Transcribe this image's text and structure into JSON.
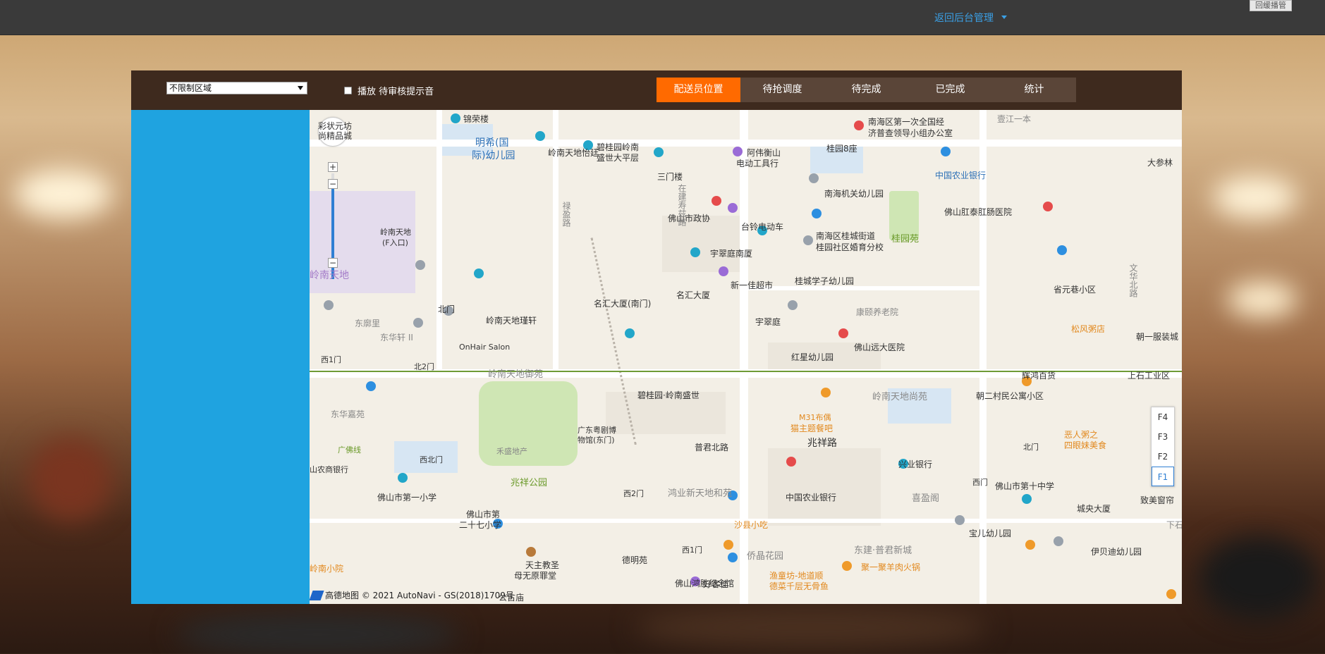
{
  "header": {
    "back_link": "返回后台管理",
    "corner_button": "回缓播管"
  },
  "toolbar": {
    "region_select": {
      "value": "不限制区域"
    },
    "sound_toggle_label": "播放 待审核提示音",
    "tabs": [
      {
        "label": "配送员位置",
        "active": true
      },
      {
        "label": "待抢调度",
        "active": false
      },
      {
        "label": "待完成",
        "active": false
      },
      {
        "label": "已完成",
        "active": false
      },
      {
        "label": "统计",
        "active": false
      }
    ]
  },
  "map": {
    "floors": [
      "F4",
      "F3",
      "F2",
      "F1"
    ],
    "active_floor": "F1",
    "attribution": "高德地图 © 2021 AutoNavi - GS(2018)1709号",
    "labels": {
      "l1": "彩状元坊",
      "l2": "尚精品城",
      "l3": "锦荣楼",
      "l4": "明希(国",
      "l5": "际)幼儿园",
      "l6": "岭南天地怡廷",
      "l7": "碧桂园岭南",
      "l8": "盛世大平层",
      "l9": "三门楼",
      "l10": "阿伟衡山",
      "l11": "电动工具行",
      "l12": "桂园8座",
      "l13": "南海区第一次全国经",
      "l14": "济普查领导小组办公室",
      "l15": "壹江一本",
      "l16": "中国农业银行",
      "l17": "大参林",
      "l18": "南海机关幼儿园",
      "l19": "佛山肛泰肛肠医院",
      "l20": "桂园苑",
      "l21": "佛山市政协",
      "l22": "台铃电动车",
      "l23": "南海区桂城街道",
      "l24": "桂园社区婚育分校",
      "l25": "宇翠庭南厦",
      "l26": "岭南天地",
      "l27": "(F入口)",
      "l28": "岭南天地",
      "l29": "新一佳超市",
      "l30": "名汇大厦",
      "l31": "桂城学子幼儿园",
      "l32": "省元巷小区",
      "l33": "名汇大厦(南门)",
      "l34": "宇翠庭",
      "l35": "康颐养老院",
      "l36": "岭南天地瑾轩",
      "l37": "北门",
      "l38": "东廓里",
      "l39": "东华轩 II",
      "l40": "松风粥店",
      "l41": "朝一服装城",
      "l42": "佛山远大医院",
      "l43": "OnHair Salon",
      "l44": "西1门",
      "l45": "北2门",
      "l46": "红星幼儿园",
      "l47": "岭南天地御苑",
      "l48": "辉鸿百货",
      "l49": "上石工业区",
      "l50": "碧桂园·岭南盛世",
      "l51": "岭南天地尚苑",
      "l52": "朝二村民公寓小区",
      "l53": "东华嘉苑",
      "l54": "M31布偶",
      "l55": "猫主题餐吧",
      "l56": "广东粤剧博",
      "l57": "物馆(东门)",
      "l58": "普君北路",
      "l59": "兆祥路",
      "l60": "北门",
      "l61": "恶人粥之",
      "l62": "四眼妹美食",
      "l63": "禾盛地产",
      "l64": "西北门",
      "l65": "兴业银行",
      "l66": "山农商银行",
      "l67": "兆祥公园",
      "l68": "西2门",
      "l69": "鸿业新天地和苑",
      "l70": "中国农业银行",
      "l71": "喜盈阁",
      "l72": "西门",
      "l73": "佛山市第十中学",
      "l74": "致美窗帘",
      "l75": "佛山市第一小学",
      "l76": "佛山市第",
      "l77": "二十七小学",
      "l78": "沙县小吃",
      "l79": "宝儿幼儿园",
      "l80": "城央大厦",
      "l81": "下石",
      "l82": "天主教圣",
      "l83": "母无原罪堂",
      "l84": "德明苑",
      "l85": "西1门",
      "l86": "侨晶花园",
      "l87": "东建·普君新城",
      "l88": "伊贝迪幼儿园",
      "l89": "岭南小院",
      "l90": "佛山鸿胜纪念馆",
      "l91": "好客佳",
      "l92": "渔童坊-地道顺",
      "l93": "德菜千层无骨鱼",
      "l94": "聚一聚羊肉火锅",
      "l95": "公古庙",
      "l96": "禄盈路",
      "l97": "在建寿兹路",
      "l98": "文华北路",
      "l99": "广佛线"
    }
  }
}
